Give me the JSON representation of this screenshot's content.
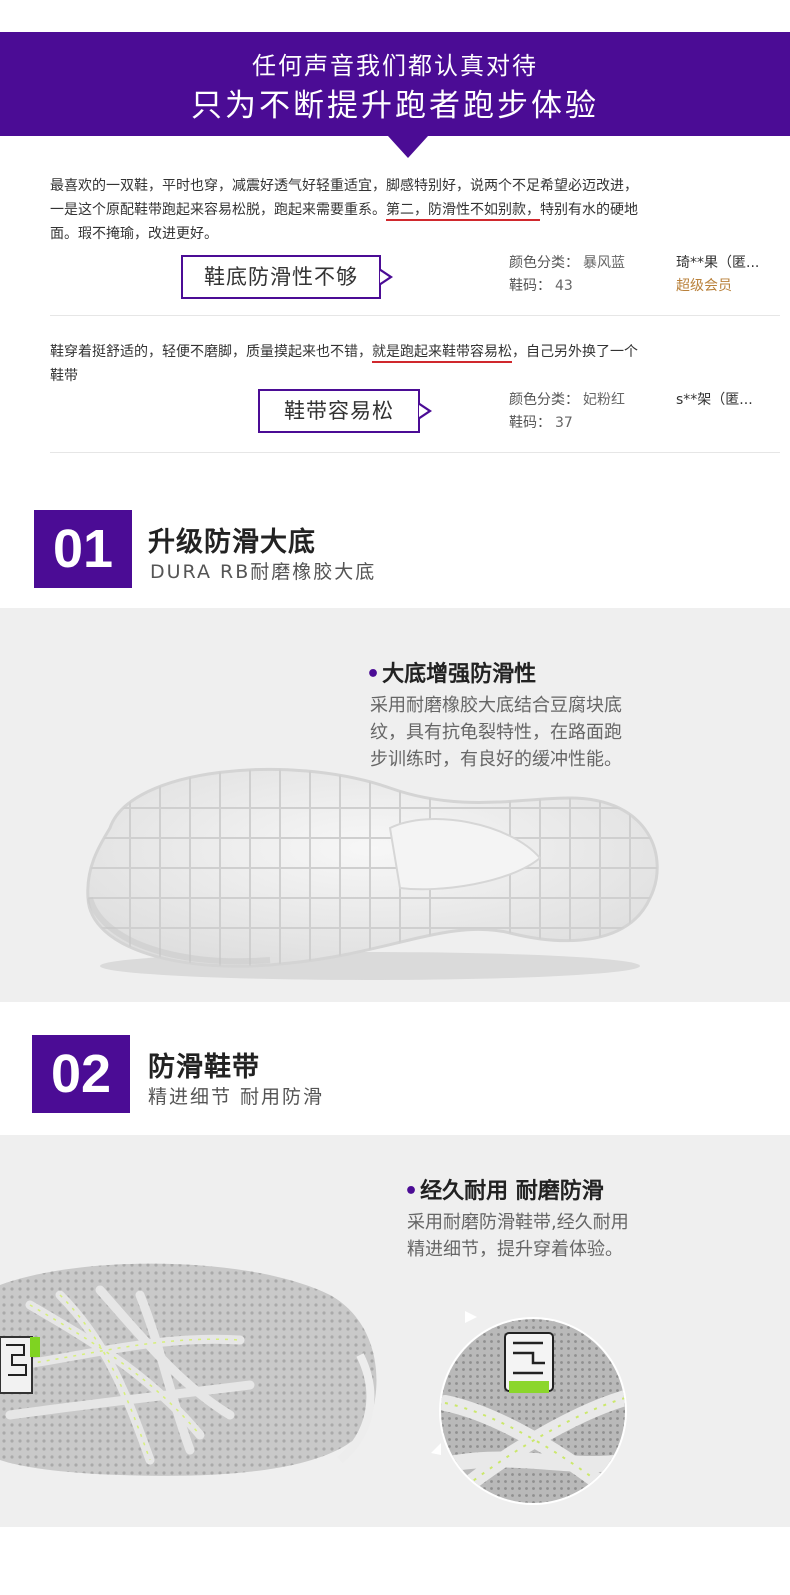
{
  "banner": {
    "line1": "任何声音我们都认真对待",
    "line2": "只为不断提升跑者跑步体验"
  },
  "reviews": [
    {
      "text_before": "最喜欢的一双鞋，平时也穿，减震好透气好轻重适宜，脚感特别好，说两个不足希望必迈改进，一是这个原配鞋带跑起来容易松脱，跑起来需要重系。",
      "text_highlight": "第二，防滑性不如别款，",
      "text_after": "特别有水的硬地面。瑕不掩瑜，改进更好。",
      "tag": "鞋底防滑性不够",
      "color_label": "颜色分类：",
      "color_value": "暴风蓝",
      "size_label": "鞋码：",
      "size_value": "43",
      "reviewer": "琦**果（匿...",
      "member": "超级会员"
    },
    {
      "text_before": "鞋穿着挺舒适的，轻便不磨脚，质量摸起来也不错，",
      "text_highlight": "就是跑起来鞋带容易松",
      "text_after": "，自己另外换了一个鞋带",
      "tag": "鞋带容易松",
      "color_label": "颜色分类：",
      "color_value": "妃粉红",
      "size_label": "鞋码：",
      "size_value": "37",
      "reviewer": "s**架（匿..."
    }
  ],
  "sections": [
    {
      "number": "01",
      "title": "升级防滑大底",
      "subtitle": "DURA RB耐磨橡胶大底",
      "feature_title": "大底增强防滑性",
      "feature_desc": [
        "采用耐磨橡胶大底结合豆腐块底",
        "纹，具有抗龟裂特性，在路面跑",
        "步训练时，有良好的缓冲性能。"
      ],
      "dot": "•"
    },
    {
      "number": "02",
      "title": "防滑鞋带",
      "subtitle": "精进细节 耐用防滑",
      "feature_title": "经久耐用 耐磨防滑",
      "feature_desc": [
        "采用耐磨防滑鞋带,经久耐用",
        "精进细节，提升穿着体验。"
      ],
      "dot": "•"
    }
  ],
  "colors": {
    "brand_purple": "#4b0c95",
    "highlight_red": "#d0282d",
    "member_gold": "#b9813b",
    "panel_grey": "#efefef"
  }
}
